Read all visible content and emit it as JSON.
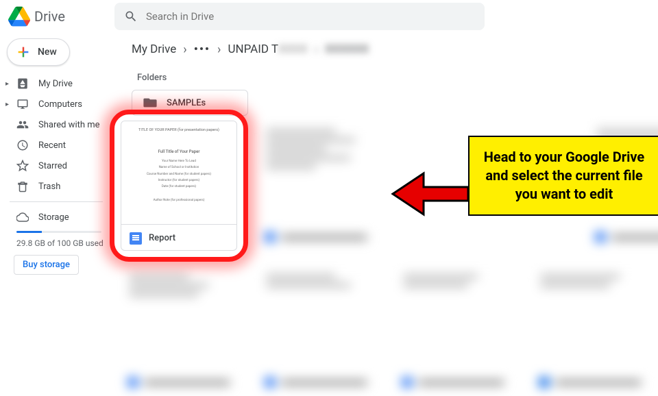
{
  "header": {
    "app_name": "Drive",
    "search_placeholder": "Search in Drive"
  },
  "sidebar": {
    "new_label": "New",
    "items": [
      {
        "label": "My Drive",
        "icon": "mydrive"
      },
      {
        "label": "Computers",
        "icon": "computers"
      },
      {
        "label": "Shared with me",
        "icon": "shared"
      },
      {
        "label": "Recent",
        "icon": "recent"
      },
      {
        "label": "Starred",
        "icon": "starred"
      },
      {
        "label": "Trash",
        "icon": "trash"
      }
    ],
    "storage_label": "Storage",
    "storage_text": "29.8 GB of 100 GB used",
    "buy_label": "Buy storage"
  },
  "breadcrumb": {
    "root": "My Drive",
    "overflow": "•••",
    "current": "UNPAID T",
    "obscured1": "XXXX",
    "obscured2": "XXXXXX"
  },
  "content": {
    "folders_label": "Folders",
    "folder_name": "SAMPLEs",
    "file_name": "Report",
    "thumb": {
      "header": "TITLE OF YOUR PAPER (for presentation papers)",
      "big": "Full Title of Your Paper",
      "l1": "Your Name Here To Lead",
      "l2": "Name of School or Institution",
      "l3": "Course Number and Name (for student papers)",
      "l4": "Instructor (for student papers)",
      "l5": "Date (for student papers)",
      "author": "Author Note (for professional papers)"
    }
  },
  "annotation": {
    "callout": "Head to your Google Drive and select the current file you want to edit"
  }
}
